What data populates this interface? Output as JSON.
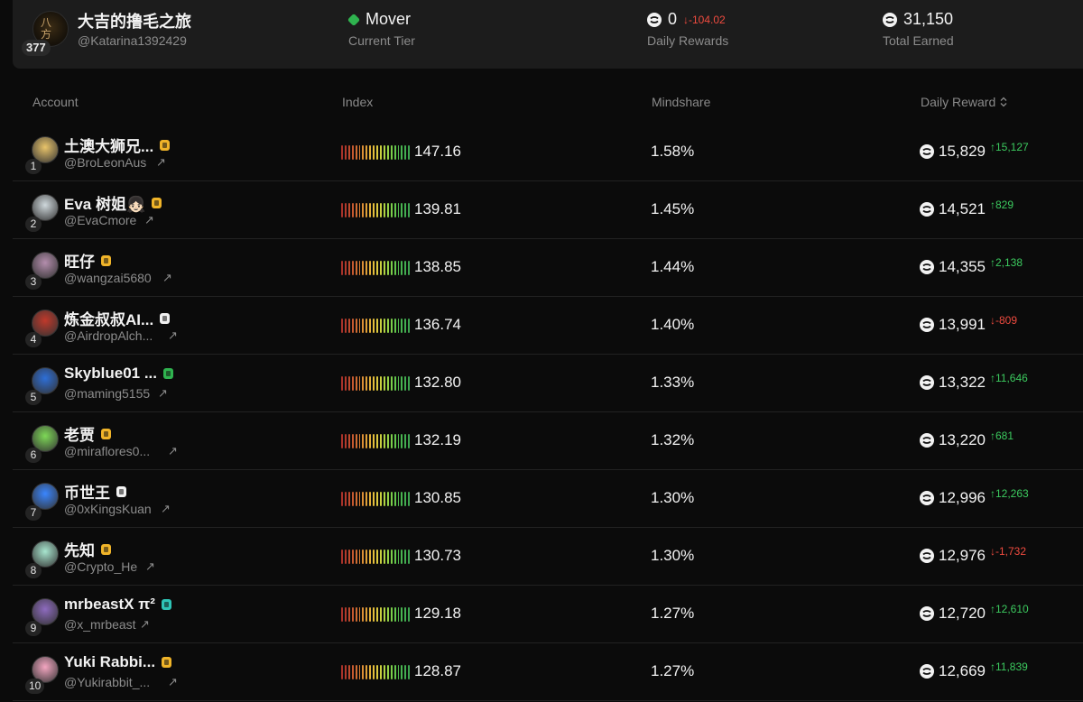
{
  "profile": {
    "name": "大吉的撸毛之旅",
    "handle": "@Katarina1392429",
    "rank": "377",
    "tier": "Mover",
    "tier_label": "Current Tier",
    "daily_rewards": "0",
    "daily_rewards_delta": "↓-104.02",
    "daily_rewards_label": "Daily Rewards",
    "total_earned": "31,150",
    "total_earned_label": "Total Earned"
  },
  "columns": {
    "account": "Account",
    "index": "Index",
    "mindshare": "Mindshare",
    "daily_reward": "Daily Reward"
  },
  "rows": [
    {
      "rank": "1",
      "name": "土澳大狮兄...",
      "handle": "@BroLeonAus",
      "badge": "gold",
      "index": "147.16",
      "mindshare": "1.58%",
      "reward": "15,829",
      "delta": "↑15,127",
      "dir": "up",
      "avatar": "#e9c46a"
    },
    {
      "rank": "2",
      "name": "Eva 树姐👧🏻",
      "handle": "@EvaCmore",
      "badge": "gold",
      "index": "139.81",
      "mindshare": "1.45%",
      "reward": "14,521",
      "delta": "↑829",
      "dir": "up",
      "avatar": "#cfd8dc"
    },
    {
      "rank": "3",
      "name": "旺仔",
      "handle": "@wangzai5680",
      "badge": "gold",
      "index": "138.85",
      "mindshare": "1.44%",
      "reward": "14,355",
      "delta": "↑2,138",
      "dir": "up",
      "avatar": "#b48ead"
    },
    {
      "rank": "4",
      "name": "炼金叔叔AI...",
      "handle": "@AirdropAlch...",
      "badge": "white",
      "index": "136.74",
      "mindshare": "1.40%",
      "reward": "13,991",
      "delta": "↓-809",
      "dir": "down",
      "avatar": "#c0392b"
    },
    {
      "rank": "5",
      "name": "Skyblue01 ...",
      "handle": "@maming5155",
      "badge": "green",
      "index": "132.80",
      "mindshare": "1.33%",
      "reward": "13,322",
      "delta": "↑11,646",
      "dir": "up",
      "avatar": "#2e6fd8"
    },
    {
      "rank": "6",
      "name": "老贾",
      "handle": "@miraflores0...",
      "badge": "gold",
      "index": "132.19",
      "mindshare": "1.32%",
      "reward": "13,220",
      "delta": "↑681",
      "dir": "up",
      "avatar": "#7ed957"
    },
    {
      "rank": "7",
      "name": "币世王",
      "handle": "@0xKingsKuan",
      "badge": "white",
      "index": "130.85",
      "mindshare": "1.30%",
      "reward": "12,996",
      "delta": "↑12,263",
      "dir": "up",
      "avatar": "#3a86ff"
    },
    {
      "rank": "8",
      "name": "先知",
      "handle": "@Crypto_He",
      "badge": "gold",
      "index": "130.73",
      "mindshare": "1.30%",
      "reward": "12,976",
      "delta": "↓-1,732",
      "dir": "down",
      "avatar": "#a8e6cf"
    },
    {
      "rank": "9",
      "name": "mrbeastX π²",
      "handle": "@x_mrbeast",
      "badge": "teal",
      "index": "129.18",
      "mindshare": "1.27%",
      "reward": "12,720",
      "delta": "↑12,610",
      "dir": "up",
      "avatar": "#8e6bbf"
    },
    {
      "rank": "10",
      "name": "Yuki Rabbi...",
      "handle": "@Yukirabbit_...",
      "badge": "gold",
      "index": "128.87",
      "mindshare": "1.27%",
      "reward": "12,669",
      "delta": "↑11,839",
      "dir": "up",
      "avatar": "#f4a6c1"
    }
  ]
}
